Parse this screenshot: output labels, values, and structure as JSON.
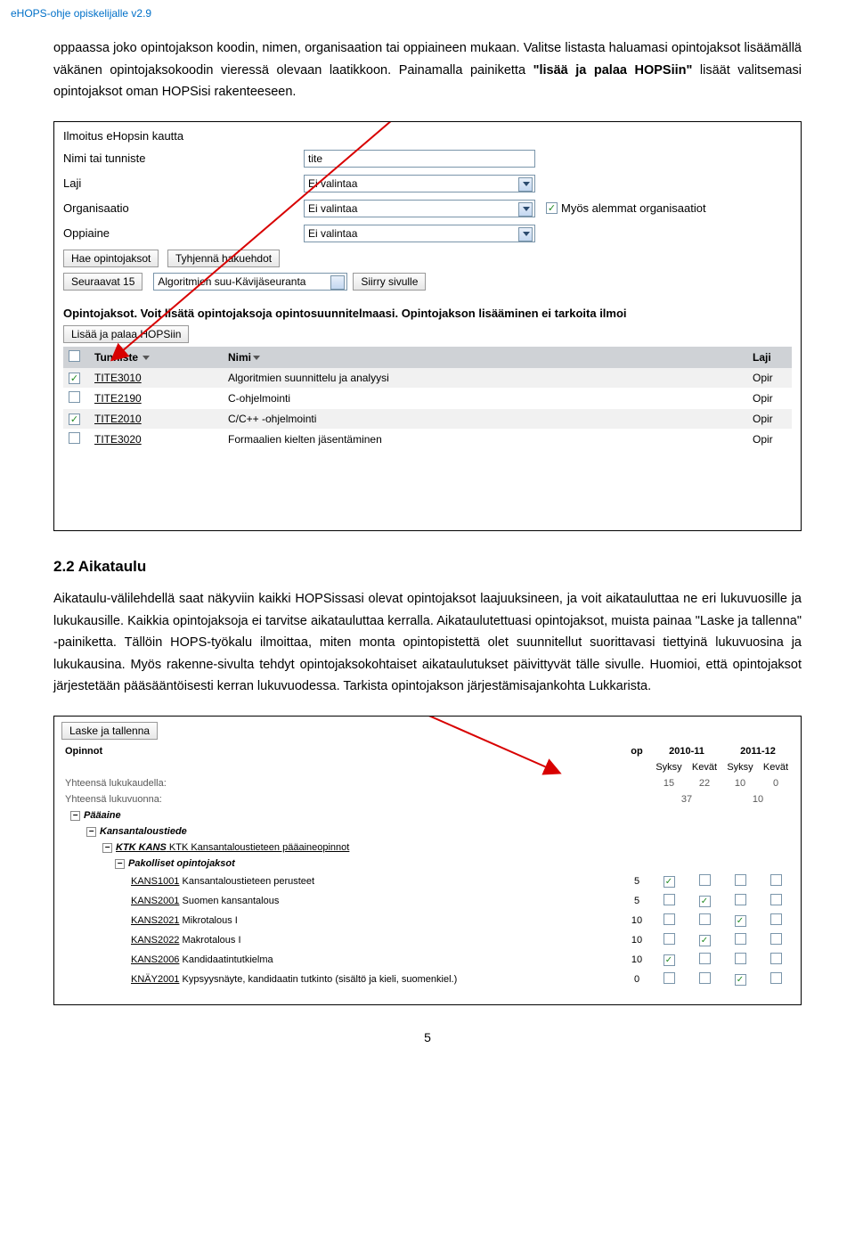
{
  "page_header": "eHOPS-ohje opiskelijalle v2.9",
  "page_number": "5",
  "para1": "oppaassa joko opintojakson koodin, nimen, organisaation tai oppiaineen mukaan. Valitse listasta haluamasi opintojaksot lisäämällä väkänen opintojaksokoodin vieressä olevaan laatikkoon. Painamalla painiketta ",
  "para1_bold": "\"lisää ja palaa HOPSiin\"",
  "para1_tail": " lisäät valitsemasi opintojaksot oman HOPSisi rakenteeseen.",
  "heading22": "2.2 Aikataulu",
  "para2": "Aikataulu-välilehdellä saat näkyviin kaikki HOPSissasi olevat opintojaksot laajuuksineen, ja voit aikatauluttaa ne eri lukuvuosille ja lukukausille. Kaikkia opintojaksoja ei tarvitse aikatauluttaa kerralla. Aikataulutettuasi opintojaksot, muista painaa \"Laske ja tallenna\" -painiketta. Tällöin HOPS-työkalu ilmoittaa, miten monta opintopistettä olet suunnitellut suorittavasi tiettyinä lukuvuosina ja lukukausina. Myös rakenne-sivulta tehdyt opintojaksokohtaiset aikataulutukset päivittyvät tälle sivulle. Huomioi, että opintojaksot järjestetään pääsääntöisesti kerran lukuvuodessa. Tarkista opintojakson järjestämisajankohta Lukkarista.",
  "shot1": {
    "section_title": "Ilmoitus eHopsin kautta",
    "labels": {
      "nimi": "Nimi tai tunniste",
      "laji": "Laji",
      "organisaatio": "Organisaatio",
      "oppiaine": "Oppiaine"
    },
    "values": {
      "nimi": "tite",
      "laji": "Ei valintaa",
      "organisaatio": "Ei valintaa",
      "oppiaine": "Ei valintaa"
    },
    "checkbox_label": "Myös alemmat organisaatiot",
    "btn_hae": "Hae opintojaksot",
    "btn_tyhjenna": "Tyhjennä hakuehdot",
    "btn_seuraavat": "Seuraavat 15",
    "dropdown_range": "Algoritmien suu-Kävijäseuranta",
    "btn_siirry": "Siirry sivulle",
    "info_line": "Opintojaksot. Voit lisätä opintojaksoja opintosuunnitelmaasi. Opintojakson lisääminen ei tarkoita ilmoi",
    "btn_lisaa_palaa": "Lisää ja palaa HOPSiin",
    "th_tunniste": "Tunniste",
    "th_nimi": "Nimi",
    "th_laji": "Laji",
    "rows": [
      {
        "checked": true,
        "tunniste": "TITE3010",
        "nimi": "Algoritmien suunnittelu ja analyysi",
        "laji": "Opir"
      },
      {
        "checked": false,
        "tunniste": "TITE2190",
        "nimi": "C-ohjelmointi",
        "laji": "Opir"
      },
      {
        "checked": true,
        "tunniste": "TITE2010",
        "nimi": "C/C++ -ohjelmointi",
        "laji": "Opir"
      },
      {
        "checked": false,
        "tunniste": "TITE3020",
        "nimi": "Formaalien kielten jäsentäminen",
        "laji": "Opir"
      }
    ]
  },
  "shot2": {
    "btn_laske": "Laske ja tallenna",
    "hdr_opinnot": "Opinnot",
    "hdr_op": "op",
    "years": [
      "2010-11",
      "2011-12"
    ],
    "terms": [
      "Syksy",
      "Kevät",
      "Syksy",
      "Kevät"
    ],
    "lbl_lukukaudella": "Yhteensä lukukaudella:",
    "lbl_lukuvuonna": "Yhteensä lukuvuonna:",
    "vals_lukukaudella": [
      "15",
      "22",
      "10",
      "0"
    ],
    "vals_lukuvuonna": [
      "37",
      "10"
    ],
    "section_paaaine": "Pääaine",
    "section_kt": "Kansantaloustiede",
    "section_ktk": "KTK KANS",
    "section_ktk_text": " KTK Kansantaloustieteen pääaineopinnot",
    "section_pakolliset": "Pakolliset opintojaksot",
    "courses": [
      {
        "code": "KANS1001",
        "name": " Kansantaloustieteen perusteet",
        "op": "5",
        "chk": [
          true,
          false,
          false,
          false
        ]
      },
      {
        "code": "KANS2001",
        "name": " Suomen kansantalous",
        "op": "5",
        "chk": [
          false,
          true,
          false,
          false
        ]
      },
      {
        "code": "KANS2021",
        "name": " Mikrotalous I",
        "op": "10",
        "chk": [
          false,
          false,
          true,
          false
        ]
      },
      {
        "code": "KANS2022",
        "name": " Makrotalous I",
        "op": "10",
        "chk": [
          false,
          true,
          false,
          false
        ]
      },
      {
        "code": "KANS2006",
        "name": " Kandidaatintutkielma",
        "op": "10",
        "chk": [
          true,
          false,
          false,
          false
        ]
      },
      {
        "code": "KNÄY2001",
        "name": " Kypsyysnäyte, kandidaatin tutkinto (sisältö ja kieli, suomenkiel.)",
        "op": "0",
        "chk": [
          false,
          false,
          true,
          false
        ]
      }
    ]
  }
}
